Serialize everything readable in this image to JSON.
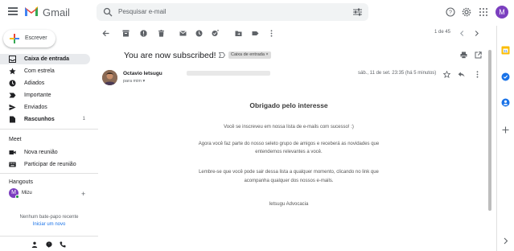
{
  "app": {
    "brand": "Gmail",
    "avatar_letter": "M",
    "accent": "#7b3fbf"
  },
  "search": {
    "placeholder": "Pesquisar e-mail"
  },
  "compose": {
    "label": "Escrever"
  },
  "nav": {
    "items": [
      {
        "label": "Caixa de entrada",
        "icon": "inbox-icon",
        "active": true
      },
      {
        "label": "Com estrela",
        "icon": "star-icon"
      },
      {
        "label": "Adiados",
        "icon": "clock-icon"
      },
      {
        "label": "Importante",
        "icon": "label-important-icon"
      },
      {
        "label": "Enviados",
        "icon": "send-icon"
      },
      {
        "label": "Rascunhos",
        "icon": "draft-icon",
        "count": "1"
      }
    ]
  },
  "meet": {
    "title": "Meet",
    "new_meeting": "Nova reunião",
    "join_meeting": "Participar de reunião"
  },
  "hangouts": {
    "title": "Hangouts",
    "user_letter": "M",
    "user_name": "Mizu",
    "no_chats": "Nenhum bate-papo recente",
    "start_link": "Iniciar um novo"
  },
  "toolbar": {
    "pager": "1 de 45"
  },
  "message": {
    "subject": "You are now subscribed!",
    "label": "Caixa de entrada",
    "sender_name": "Octavio Ietsugu",
    "to_me": "para mim",
    "date": "sáb., 11 de set. 23:35 (há 5 minutos)",
    "body": {
      "title": "Obrigado pelo interesse",
      "p1": "Você se inscreveu em nossa lista de e-mails com sucesso! :)",
      "p2a": "Agora você faz parte do nosso seleto grupo de amigos e receberá as novidades que",
      "p2b": "entendemos relevantes a você.",
      "p3a": "Lembre-se que você pode sair dessa lista a qualquer momento, clicando no link que",
      "p3b": "acompanha qualquer dos nossos e-mails.",
      "signature": "Ietsugu Advocacia"
    }
  }
}
